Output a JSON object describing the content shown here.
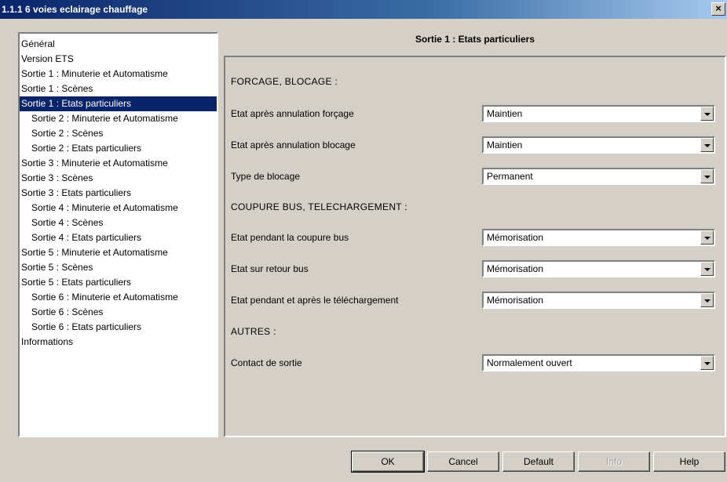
{
  "window": {
    "title": "1.1.1 6 voies eclairage chauffage",
    "close_glyph": "×"
  },
  "tree": {
    "items": [
      {
        "label": "Général",
        "level": 0,
        "selected": false
      },
      {
        "label": "Version ETS",
        "level": 0,
        "selected": false
      },
      {
        "label": "Sortie 1 : Minuterie et Automatisme",
        "level": 0,
        "selected": false
      },
      {
        "label": "Sortie 1 : Scènes",
        "level": 0,
        "selected": false
      },
      {
        "label": "Sortie 1 : Etats particuliers",
        "level": 0,
        "selected": true
      },
      {
        "label": "Sortie 2 : Minuterie et Automatisme",
        "level": 1,
        "selected": false
      },
      {
        "label": "Sortie 2 : Scènes",
        "level": 1,
        "selected": false
      },
      {
        "label": "Sortie 2 : Etats particuliers",
        "level": 1,
        "selected": false
      },
      {
        "label": "Sortie 3 : Minuterie et Automatisme",
        "level": 0,
        "selected": false
      },
      {
        "label": "Sortie 3 : Scènes",
        "level": 0,
        "selected": false
      },
      {
        "label": "Sortie 3 : Etats particuliers",
        "level": 0,
        "selected": false
      },
      {
        "label": "Sortie 4 : Minuterie et Automatisme",
        "level": 1,
        "selected": false
      },
      {
        "label": "Sortie 4 : Scènes",
        "level": 1,
        "selected": false
      },
      {
        "label": "Sortie 4 : Etats particuliers",
        "level": 1,
        "selected": false
      },
      {
        "label": "Sortie 5 : Minuterie et Automatisme",
        "level": 0,
        "selected": false
      },
      {
        "label": "Sortie 5 : Scènes",
        "level": 0,
        "selected": false
      },
      {
        "label": "Sortie 5 : Etats particuliers",
        "level": 0,
        "selected": false
      },
      {
        "label": "Sortie 6 : Minuterie et Automatisme",
        "level": 1,
        "selected": false
      },
      {
        "label": "Sortie 6 : Scènes",
        "level": 1,
        "selected": false
      },
      {
        "label": "Sortie 6 : Etats particuliers",
        "level": 1,
        "selected": false
      },
      {
        "label": "Informations",
        "level": 0,
        "selected": false
      }
    ]
  },
  "panel": {
    "title": "Sortie 1 : Etats particuliers",
    "sections": {
      "forcage": "FORCAGE, BLOCAGE :",
      "coupure": "COUPURE BUS, TELECHARGEMENT :",
      "autres": "AUTRES :"
    },
    "params": {
      "etat_apres_annulation_forcage": {
        "label": "Etat après annulation forçage",
        "value": "Maintien"
      },
      "etat_apres_annulation_blocage": {
        "label": "Etat après annulation blocage",
        "value": "Maintien"
      },
      "type_de_blocage": {
        "label": "Type de blocage",
        "value": "Permanent"
      },
      "etat_pendant_coupure_bus": {
        "label": "Etat pendant la coupure bus",
        "value": "Mémorisation"
      },
      "etat_sur_retour_bus": {
        "label": "Etat sur retour bus",
        "value": "Mémorisation"
      },
      "etat_pendant_telechargement": {
        "label": "Etat pendant et après le téléchargement",
        "value": "Mémorisation"
      },
      "contact_de_sortie": {
        "label": "Contact de sortie",
        "value": "Normalement ouvert"
      }
    }
  },
  "buttons": {
    "ok": "OK",
    "cancel": "Cancel",
    "default": "Default",
    "info": "Info",
    "help": "Help"
  }
}
